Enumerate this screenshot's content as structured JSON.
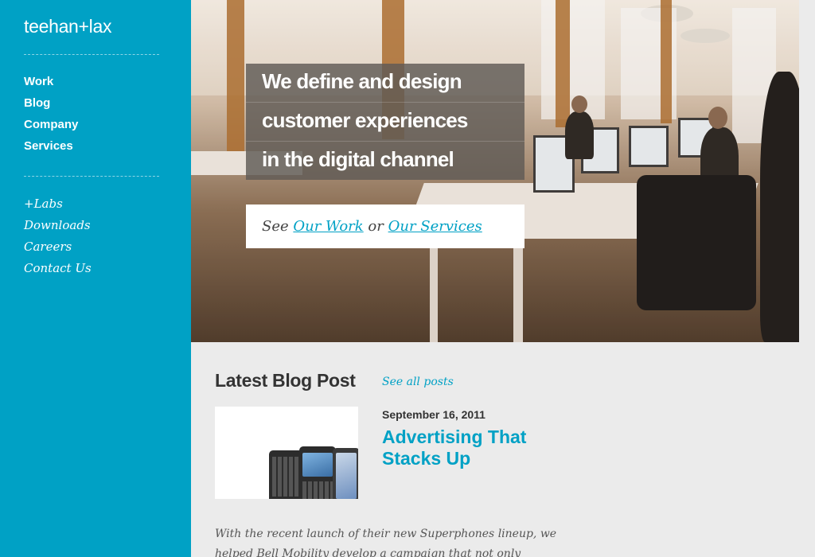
{
  "brand": {
    "logo_text": "teehan+lax"
  },
  "nav_primary": [
    {
      "label": "Work"
    },
    {
      "label": "Blog"
    },
    {
      "label": "Company"
    },
    {
      "label": "Services"
    }
  ],
  "nav_secondary": [
    {
      "label": "+Labs"
    },
    {
      "label": "Downloads"
    },
    {
      "label": "Careers"
    },
    {
      "label": "Contact Us"
    }
  ],
  "hero": {
    "tagline_lines": [
      "We define and design",
      "customer experiences",
      "in the digital channel"
    ],
    "cta_prefix": "See",
    "cta_link_work": "Our Work",
    "cta_middle": "or",
    "cta_link_services": "Our Services"
  },
  "blog": {
    "heading": "Latest Blog Post",
    "see_all": "See all posts",
    "post": {
      "date": "September 16, 2011",
      "title": "Advertising That Stacks Up",
      "excerpt": "With the recent launch of their new Superphones lineup, we helped Bell Mobility develop a campaign that not only introduced"
    }
  },
  "colors": {
    "sidebar": "#00a1c5",
    "accent": "#00a1c5",
    "page_bg": "#ebebeb",
    "heading": "#333333"
  }
}
